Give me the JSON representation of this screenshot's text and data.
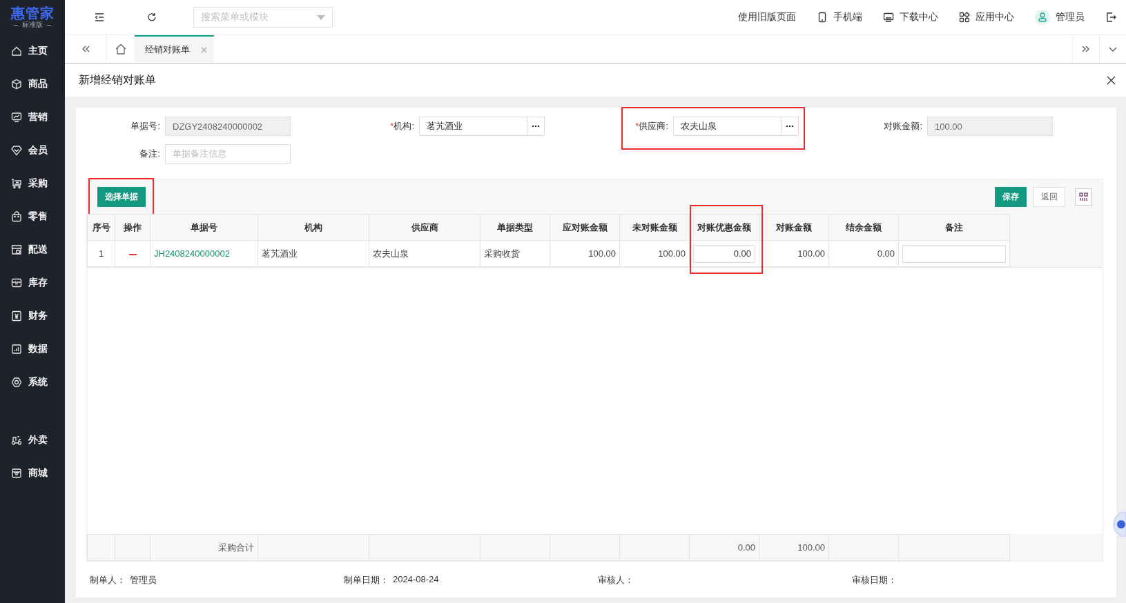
{
  "logo": {
    "title": "惠管家",
    "subtitle": "标准版"
  },
  "sidebar": {
    "items": [
      {
        "label": "主页"
      },
      {
        "label": "商品"
      },
      {
        "label": "营销"
      },
      {
        "label": "会员"
      },
      {
        "label": "采购"
      },
      {
        "label": "零售"
      },
      {
        "label": "配送"
      },
      {
        "label": "库存"
      },
      {
        "label": "财务"
      },
      {
        "label": "数据"
      },
      {
        "label": "系统"
      }
    ],
    "extra_items": [
      {
        "label": "外卖"
      },
      {
        "label": "商城"
      }
    ]
  },
  "header": {
    "search": {
      "placeholder": "搜索菜单或模块"
    },
    "links": [
      {
        "label": "使用旧版页面"
      },
      {
        "label": "手机端"
      },
      {
        "label": "下载中心"
      },
      {
        "label": "应用中心"
      },
      {
        "label": "管理员"
      }
    ]
  },
  "tabs": [
    {
      "label": "经销对账单",
      "selected": true
    }
  ],
  "page": {
    "title": "新增经销对账单"
  },
  "form": {
    "fields": [
      {
        "label": "单据号:",
        "kind": "readonly",
        "value": "DZGY2408240000002",
        "highlighted": false
      },
      {
        "label": "机构:",
        "required_mark": "*",
        "kind": "picker",
        "value": "茗艽酒业",
        "highlighted": false
      },
      {
        "label": "供应商:",
        "required_mark": "*",
        "kind": "picker",
        "value": "农夫山泉",
        "highlighted": true
      },
      {
        "label": "对账金额:",
        "kind": "readonly",
        "value": "100.00",
        "highlighted": false
      },
      {
        "label": "备注:",
        "kind": "text",
        "placeholder": "单据备注信息",
        "highlighted": false
      }
    ]
  },
  "toolbar": {
    "select_button": {
      "label": "选择单据",
      "highlighted": true
    },
    "buttons": [
      {
        "label": "保存",
        "kind": "primary"
      },
      {
        "label": "返回",
        "kind": "default"
      }
    ]
  },
  "table": {
    "columns": [
      {
        "label": "序号",
        "highlighted": false
      },
      {
        "label": "操作",
        "highlighted": false
      },
      {
        "label": "单据号",
        "highlighted": false
      },
      {
        "label": "机构",
        "highlighted": false
      },
      {
        "label": "供应商",
        "highlighted": false
      },
      {
        "label": "单据类型",
        "highlighted": false
      },
      {
        "label": "应对账金额",
        "highlighted": false
      },
      {
        "label": "未对账金额",
        "highlighted": false
      },
      {
        "label": "对账优惠金额",
        "highlighted": true
      },
      {
        "label": "对账金额",
        "highlighted": false
      },
      {
        "label": "结余金额",
        "highlighted": false
      },
      {
        "label": "备注",
        "highlighted": false
      }
    ],
    "rows": [
      {
        "index": "1",
        "doc_no": "JH2408240000002",
        "org": "茗艽酒业",
        "supplier": "农夫山泉",
        "doc_type": "采购收货",
        "due": "100.00",
        "unreconciled": "100.00",
        "discount": "0.00",
        "amount": "100.00",
        "balance": "0.00"
      }
    ],
    "summary": {
      "label": "采购合计",
      "discount": "0.00",
      "amount": "100.00"
    }
  },
  "footer": [
    {
      "label": "制单人：",
      "value": "管理员"
    },
    {
      "label": "制单日期：",
      "value": "2024-08-24"
    },
    {
      "label": "审核人："
    },
    {
      "label": "审核日期："
    }
  ]
}
